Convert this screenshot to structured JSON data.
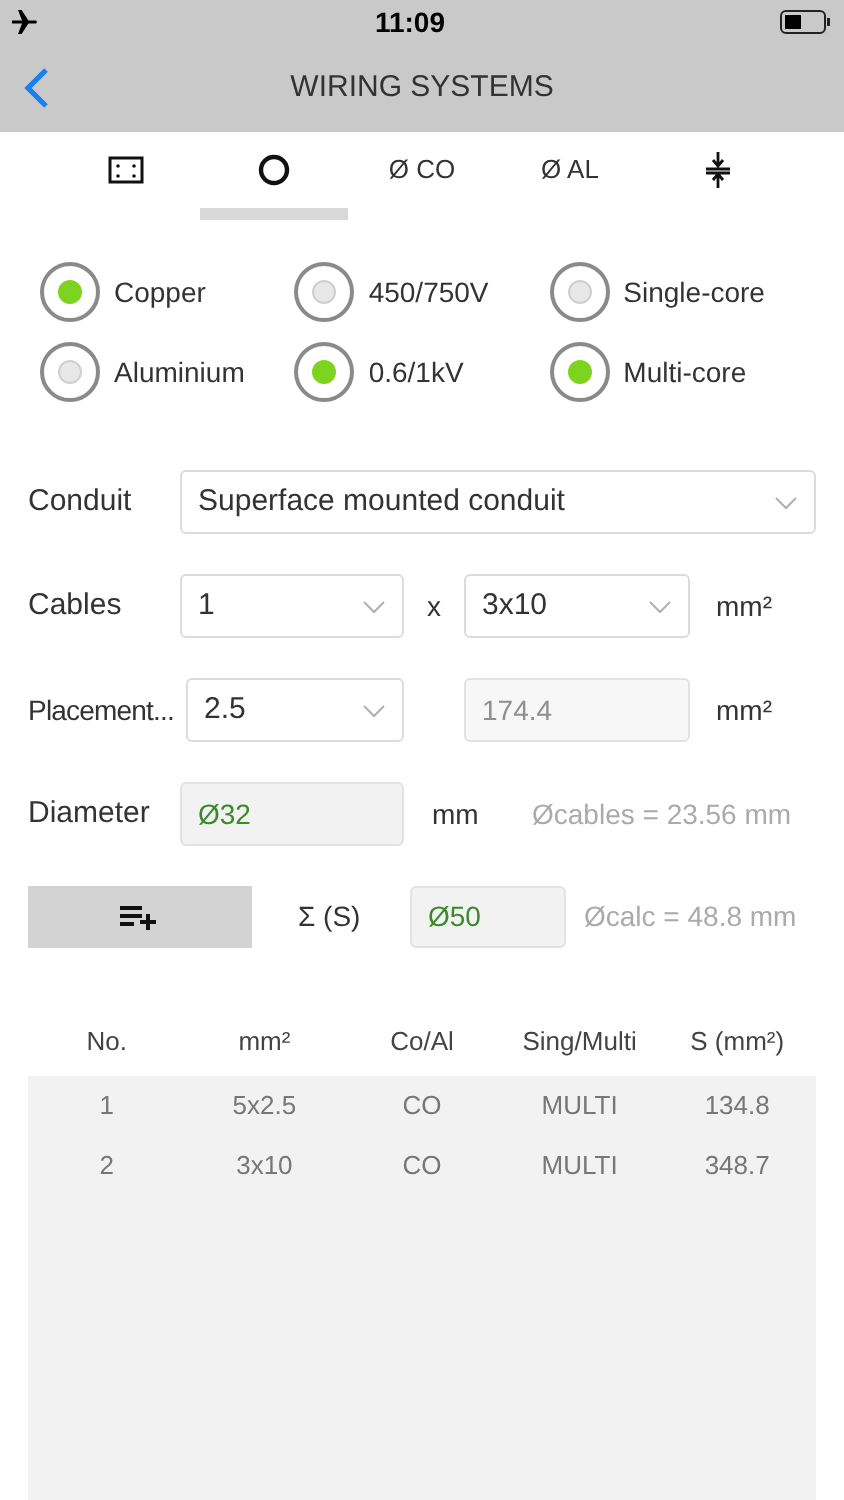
{
  "status_bar": {
    "time": "11:09"
  },
  "nav": {
    "title": "WIRING SYSTEMS"
  },
  "tabs": [
    {
      "kind": "frame",
      "selected": false
    },
    {
      "kind": "circle",
      "selected": true
    },
    {
      "kind": "text",
      "label": "Ø CO",
      "selected": false
    },
    {
      "kind": "text",
      "label": "Ø AL",
      "selected": false
    },
    {
      "kind": "spacing",
      "selected": false
    }
  ],
  "radio_groups": [
    {
      "options": [
        {
          "label": "Copper",
          "selected": true
        },
        {
          "label": "Aluminium",
          "selected": false
        }
      ]
    },
    {
      "options": [
        {
          "label": "450/750V",
          "selected": false
        },
        {
          "label": "0.6/1kV",
          "selected": true
        }
      ]
    },
    {
      "options": [
        {
          "label": "Single-core",
          "selected": false
        },
        {
          "label": "Multi-core",
          "selected": true
        }
      ]
    }
  ],
  "conduit": {
    "label": "Conduit",
    "value": "Superface mounted conduit"
  },
  "cables": {
    "label": "Cables",
    "count": "1",
    "times": "x",
    "section": "3x10",
    "unit": "mm²"
  },
  "placement": {
    "label": "Placement...",
    "value": "2.5",
    "area": "174.4",
    "unit": "mm²"
  },
  "diameter": {
    "label": "Diameter",
    "value": "Ø32",
    "unit": "mm",
    "note": "Øcables = 23.56 mm"
  },
  "sum": {
    "label": "Σ (S)",
    "value": "Ø50",
    "note": "Øcalc = 48.8 mm"
  },
  "table": {
    "columns": [
      "No.",
      "mm²",
      "Co/Al",
      "Sing/Multi",
      "S (mm²)"
    ],
    "rows": [
      [
        "1",
        "5x2.5",
        "CO",
        "MULTI",
        "134.8"
      ],
      [
        "2",
        "3x10",
        "CO",
        "MULTI",
        "348.7"
      ]
    ]
  }
}
